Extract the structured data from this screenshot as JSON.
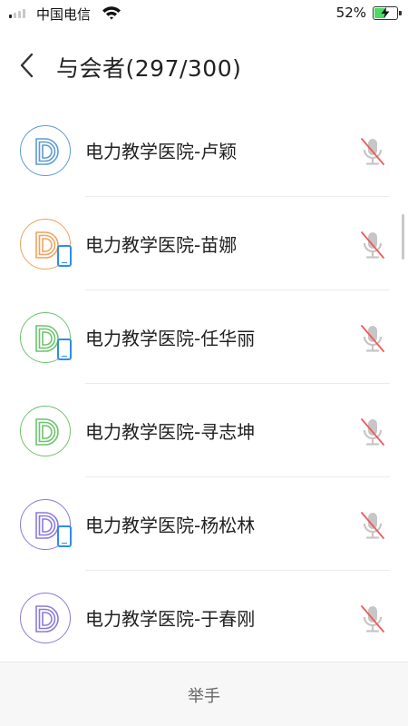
{
  "status_bar": {
    "carrier": "中国电信",
    "battery_percent": "52%",
    "battery_level": 0.52,
    "signal_bars_filled": 1
  },
  "header": {
    "back_icon": "chevron-left-icon",
    "title": "与会者(297/300)"
  },
  "participants": [
    {
      "name": "电力教学医院-卢颖",
      "avatar_color": "#5b9bd5",
      "on_phone": false,
      "muted": true
    },
    {
      "name": "电力教学医院-苗娜",
      "avatar_color": "#f0a35e",
      "on_phone": true,
      "muted": true
    },
    {
      "name": "电力教学医院-任华丽",
      "avatar_color": "#6cc46c",
      "on_phone": true,
      "muted": true
    },
    {
      "name": "电力教学医院-寻志坤",
      "avatar_color": "#6cc46c",
      "on_phone": false,
      "muted": true
    },
    {
      "name": "电力教学医院-杨松林",
      "avatar_color": "#8b7bd8",
      "on_phone": true,
      "muted": true
    },
    {
      "name": "电力教学医院-于春刚",
      "avatar_color": "#8b7bd8",
      "on_phone": false,
      "muted": true
    }
  ],
  "footer": {
    "raise_hand_label": "举手"
  }
}
